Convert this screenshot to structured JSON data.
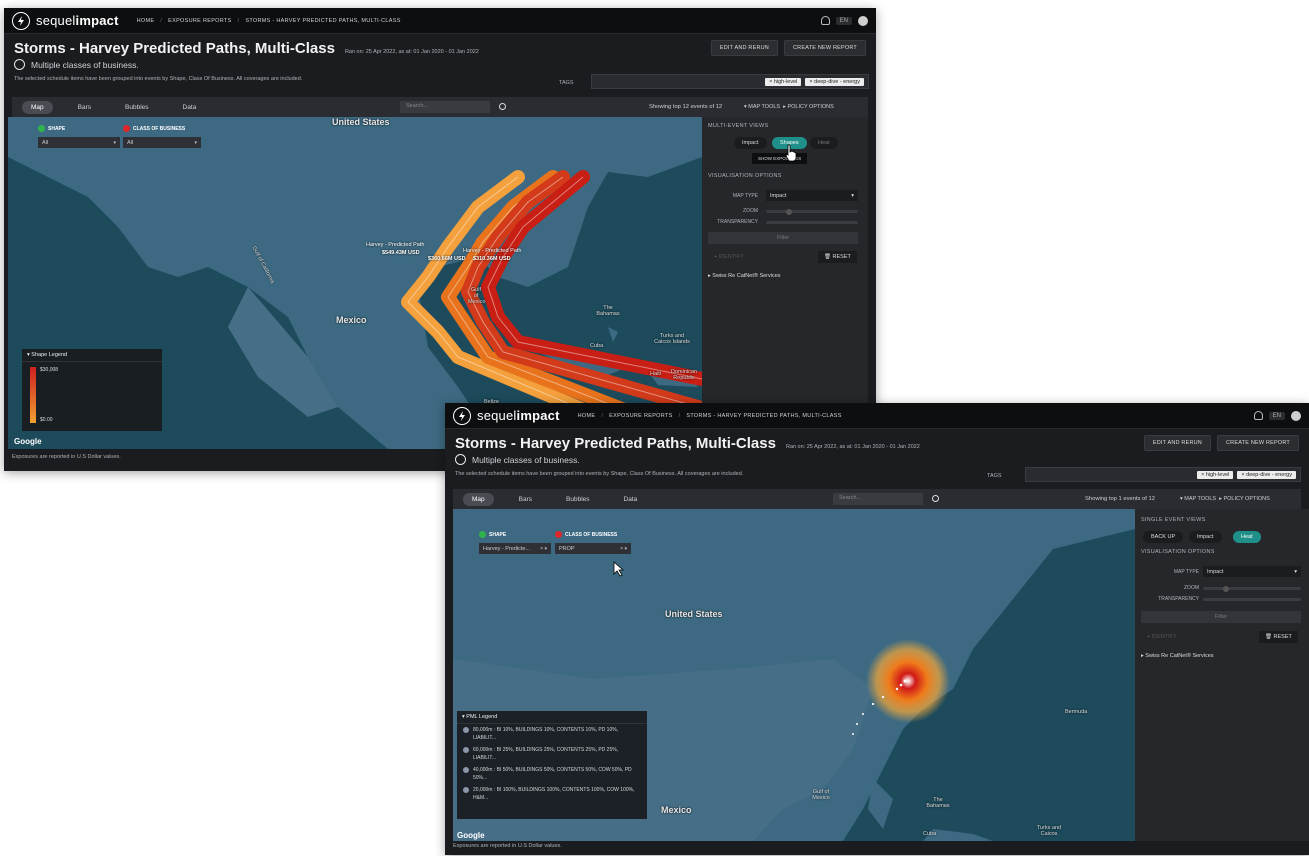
{
  "app": {
    "logo_light": "sequel",
    "logo_bold": "impact",
    "breadcrumbs": [
      "HOME",
      "EXPOSURE REPORTS",
      "STORMS - HARVEY PREDICTED PATHS, MULTI-CLASS"
    ],
    "breadcrumb_sep": "/",
    "lang": "EN"
  },
  "report": {
    "title": "Storms - Harvey Predicted Paths, Multi-Class",
    "ran_on": "Ran on: 25 Apr 2022, as at: 01 Jan 2020 - 01 Jan 2022",
    "subtitle": "Multiple classes of business.",
    "description": "The selected schedule items have been grouped into events by Shape, Class Of Business. All coverages are included.",
    "edit_button": "EDIT AND RERUN",
    "create_button": "CREATE NEW REPORT",
    "tags_label": "TAGS",
    "tags": [
      "× high-level",
      "× deep-dive - energy"
    ]
  },
  "tabs": [
    "Map",
    "Bars",
    "Bubbles",
    "Data"
  ],
  "search_placeholder": "Search...",
  "map_tools": "MAP TOOLS",
  "policy_options": "POLICY OPTIONS",
  "screen1": {
    "showing": "Showing top 12 events of 12",
    "filters": {
      "shape_label": "SHAPE",
      "cob_label": "CLASS OF BUSINESS",
      "shape_value": "All",
      "cob_value": "All"
    },
    "map_labels": {
      "us": "United States",
      "mexico": "Mexico",
      "bahamas": "The Bahamas",
      "cuba": "Cuba",
      "turks": "Turks and Caicos Islands",
      "haiti": "Haiti",
      "dominican": "Dominican Republic",
      "belize": "Belize",
      "gulf_california": "Gulf of California",
      "gulf": "Gulf of Mexico",
      "path_label_1": "Harvey - Predicted Path",
      "path_value_1": "$549.43M USD",
      "path_label_2": "Harvey - Predicted Path",
      "path_value_2": "$360.66M USD",
      "path_value_3": "$310.36M USD"
    },
    "legend": {
      "title": "Shape Legend",
      "max": "$30,008",
      "min": "$0.00"
    },
    "panel": {
      "heading": "MULTI-EVENT VIEWS",
      "pills": [
        "Impact",
        "Shapes",
        "Heat"
      ],
      "show_exposures": "SHOW EXPOSURES",
      "vis_heading": "VISUALISATION OPTIONS",
      "map_type_label": "MAP TYPE",
      "map_type_value": "Impact",
      "zoom_label": "ZOOM",
      "transparency_label": "TRANSPARENCY",
      "filter": "Filter",
      "identify": "IDENTIFY",
      "reset": "RESET",
      "catnet": "Swiss Re CatNet® Services"
    },
    "google": "Google",
    "footer": "Exposures are reported in U.S Dollar values."
  },
  "screen2": {
    "showing": "Showing top 1 events of 12",
    "filters": {
      "shape_label": "SHAPE",
      "cob_label": "CLASS OF BUSINESS",
      "shape_value": "Harvey - Predicte...",
      "cob_value": "PROP"
    },
    "map_labels": {
      "us": "United States",
      "mexico": "Mexico",
      "bermuda": "Bermuda",
      "bahamas": "The Bahamas",
      "turks": "Turks and Caicos",
      "gulf": "Gulf of Mexico",
      "cuba": "Cuba"
    },
    "legend": {
      "title": "PML Legend",
      "items": [
        "80,000m : BI 10%, BUILDINGS 10%, CONTENTS 10%, PD 10%, LIABILIT...",
        "60,000m : BI 25%, BUILDINGS 25%, CONTENTS 25%, PD 25%, LIABILIT...",
        "40,000m : BI 50%, BUILDINGS 50%, CONTENTS 50%, COW 50%, PD 50%...",
        "20,000m : BI 100%, BUILDINGS 100%, CONTENTS 100%, COW 100%, H&M..."
      ]
    },
    "panel": {
      "heading": "SINGLE EVENT VIEWS",
      "back_up": "BACK UP",
      "pills": [
        "Impact",
        "Heat"
      ],
      "vis_heading": "VISUALISATION OPTIONS",
      "map_type_label": "MAP TYPE",
      "map_type_value": "Impact",
      "zoom_label": "ZOOM",
      "transparency_label": "TRANSPARENCY",
      "filter": "Filter",
      "identify": "IDENTIFY",
      "reset": "RESET",
      "catnet": "Swiss Re CatNet® Services"
    },
    "google": "Google",
    "footer": "Exposures are reported in U.S Dollar values."
  },
  "colors": {
    "accent_teal": "#1f8f8a",
    "path_dark_red": "#c81e14",
    "path_red": "#d23a1a",
    "path_orange": "#e8731c",
    "path_light_orange": "#f4a03c",
    "shape_dot": "#2fb34a",
    "cob_dot": "#e0262a"
  }
}
